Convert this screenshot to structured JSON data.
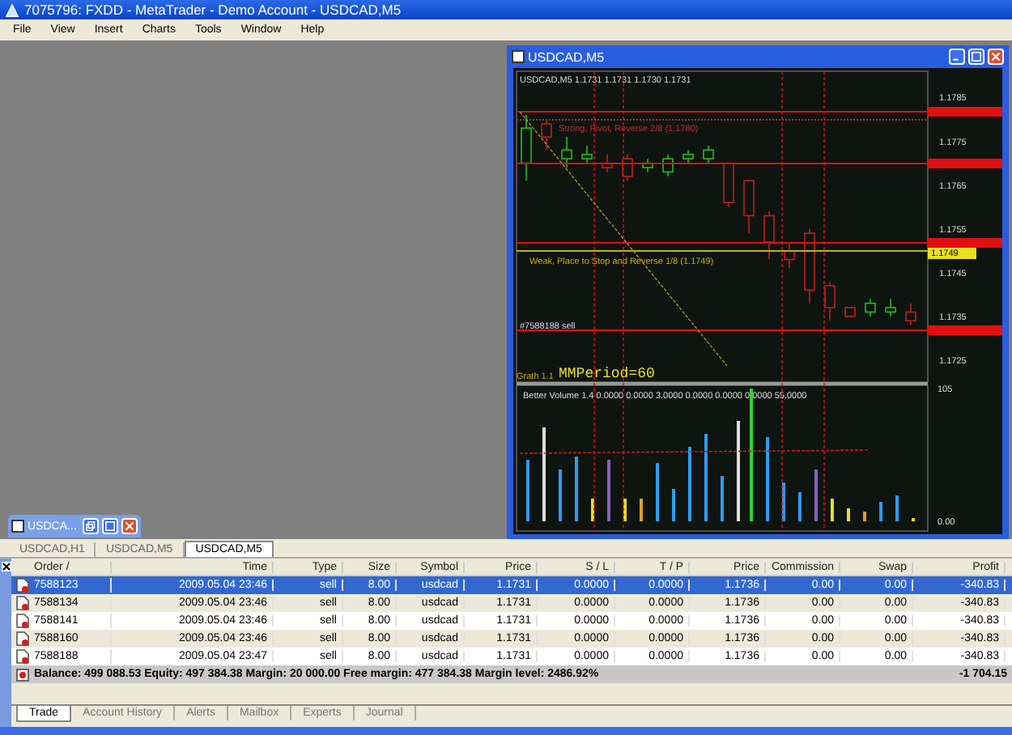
{
  "window": {
    "title": "7075796: FXDD - MetaTrader - Demo Account - USDCAD,M5"
  },
  "menu": [
    "File",
    "View",
    "Insert",
    "Charts",
    "Tools",
    "Window",
    "Help"
  ],
  "chart_window": {
    "title": "USDCAD,M5",
    "header": "USDCAD,M5  1.1731 1.1731 1.1730 1.1731",
    "chart_data": {
      "type": "candlestick",
      "ylim": [
        1.172,
        1.1791
      ],
      "yticks": [
        {
          "value": 1.1785,
          "label": "1.1785"
        },
        {
          "value": 1.1775,
          "label": "1.1775"
        },
        {
          "value": 1.1765,
          "label": "1.1765"
        },
        {
          "value": 1.1755,
          "label": "1.1755"
        },
        {
          "value": 1.1745,
          "label": "1.1745"
        },
        {
          "value": 1.1735,
          "label": "1.1735"
        },
        {
          "value": 1.1725,
          "label": "1.1725"
        }
      ],
      "ohlc": [
        [
          1.177,
          1.1781,
          1.1766,
          1.1778
        ],
        [
          1.1779,
          1.178,
          1.1773,
          1.1776
        ],
        [
          1.1771,
          1.1776,
          1.1769,
          1.1773
        ],
        [
          1.1771,
          1.1774,
          1.177,
          1.1772
        ],
        [
          1.177,
          1.1772,
          1.1768,
          1.1769
        ],
        [
          1.1771,
          1.1772,
          1.1766,
          1.1767
        ],
        [
          1.1769,
          1.1771,
          1.1768,
          1.177
        ],
        [
          1.1768,
          1.1772,
          1.1767,
          1.1771
        ],
        [
          1.1771,
          1.1773,
          1.177,
          1.1772
        ],
        [
          1.1771,
          1.1774,
          1.177,
          1.1773
        ],
        [
          1.177,
          1.177,
          1.176,
          1.1761
        ],
        [
          1.1766,
          1.1766,
          1.1754,
          1.1758
        ],
        [
          1.1758,
          1.1759,
          1.1748,
          1.1752
        ],
        [
          1.175,
          1.1752,
          1.1746,
          1.1748
        ],
        [
          1.1754,
          1.1755,
          1.1738,
          1.1741
        ],
        [
          1.1742,
          1.1743,
          1.1734,
          1.1737
        ],
        [
          1.1737,
          1.1737,
          1.1735,
          1.1735
        ],
        [
          1.1736,
          1.1739,
          1.1735,
          1.1738
        ],
        [
          1.1736,
          1.1739,
          1.1735,
          1.1737
        ],
        [
          1.1736,
          1.1738,
          1.1733,
          1.1734
        ]
      ]
    },
    "level_badge": "1.1749",
    "strong_line_label": "Strong, Pivot, Reverse 2/8 (1.1780)",
    "weak_line_label": "Weak, Place to Stop and Reverse 1/8 (1.1749)",
    "order_label": "#7588188 sell",
    "indicator_label": "Grath 1.1",
    "period_label": "MMPeriod=60",
    "volume_header": "Better Volume 1.4 0.0000 0.0000 3.0000 0.0000 0.0000 0.0000 55.0000",
    "volume_max": "105",
    "volume_min": "0.00"
  },
  "minimized_window": {
    "title": "USDCA..."
  },
  "chart_tabs": [
    {
      "label": "USDCAD,H1",
      "selected": false
    },
    {
      "label": "USDCAD,M5",
      "selected": false
    },
    {
      "label": "USDCAD,M5",
      "selected": true
    }
  ],
  "table": {
    "columns": [
      "Order  /",
      "Time",
      "Type",
      "Size",
      "Symbol",
      "Price",
      "S / L",
      "T / P",
      "Price",
      "Commission",
      "Swap",
      "Profit"
    ],
    "rows": [
      {
        "selected": true,
        "cells": [
          "7588123",
          "2009.05.04 23:46",
          "sell",
          "8.00",
          "usdcad",
          "1.1731",
          "0.0000",
          "0.0000",
          "1.1736",
          "0.00",
          "0.00",
          "-340.83"
        ]
      },
      {
        "selected": false,
        "cells": [
          "7588134",
          "2009.05.04 23:46",
          "sell",
          "8.00",
          "usdcad",
          "1.1731",
          "0.0000",
          "0.0000",
          "1.1736",
          "0.00",
          "0.00",
          "-340.83"
        ]
      },
      {
        "selected": false,
        "cells": [
          "7588141",
          "2009.05.04 23:46",
          "sell",
          "8.00",
          "usdcad",
          "1.1731",
          "0.0000",
          "0.0000",
          "1.1736",
          "0.00",
          "0.00",
          "-340.83"
        ]
      },
      {
        "selected": false,
        "cells": [
          "7588160",
          "2009.05.04 23:46",
          "sell",
          "8.00",
          "usdcad",
          "1.1731",
          "0.0000",
          "0.0000",
          "1.1736",
          "0.00",
          "0.00",
          "-340.83"
        ]
      },
      {
        "selected": false,
        "cells": [
          "7588188",
          "2009.05.04 23:47",
          "sell",
          "8.00",
          "usdcad",
          "1.1731",
          "0.0000",
          "0.0000",
          "1.1736",
          "0.00",
          "0.00",
          "-340.83"
        ]
      }
    ],
    "summary": "Balance: 499 088.53  Equity: 497 384.38  Margin: 20 000.00  Free margin: 477 384.38  Margin level: 2486.92%",
    "total_profit": "-1 704.15"
  },
  "terminal_tabs": [
    {
      "label": "Trade",
      "selected": true
    },
    {
      "label": "Account History",
      "selected": false
    },
    {
      "label": "Alerts",
      "selected": false
    },
    {
      "label": "Mailbox",
      "selected": false
    },
    {
      "label": "Experts",
      "selected": false
    },
    {
      "label": "Journal",
      "selected": false
    }
  ]
}
